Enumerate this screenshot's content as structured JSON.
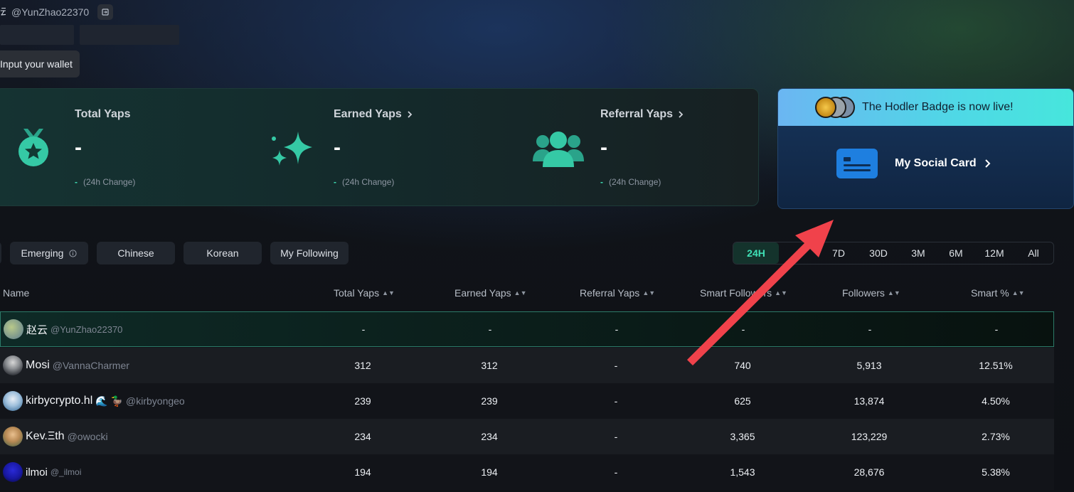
{
  "header": {
    "glyph": "云",
    "handle": "@YunZhao22370",
    "wallet_button": "Input your wallet"
  },
  "stats": [
    {
      "label": "Total Yaps",
      "value": "-",
      "change_value": "-",
      "change_label": "(24h Change)",
      "has_link": false
    },
    {
      "label": "Earned Yaps",
      "value": "-",
      "change_value": "-",
      "change_label": "(24h Change)",
      "has_link": true
    },
    {
      "label": "Referral Yaps",
      "value": "-",
      "change_value": "-",
      "change_label": "(24h Change)",
      "has_link": true
    }
  ],
  "promo": {
    "banner_text": "The Hodler Badge is now live!",
    "social_label": "My Social Card"
  },
  "filters": [
    "Emerging",
    "Chinese",
    "Korean",
    "My Following"
  ],
  "periods": [
    "24H",
    "7D",
    "30D",
    "3M",
    "6M",
    "12M",
    "All"
  ],
  "active_period": "24H",
  "table": {
    "headers": [
      "Name",
      "Total Yaps",
      "Earned Yaps",
      "Referral Yaps",
      "Smart Followers",
      "Followers",
      "Smart %"
    ],
    "rows": [
      {
        "display": "赵云",
        "handle": "@YunZhao22370",
        "emoji": "",
        "total": "-",
        "earned": "-",
        "referral": "-",
        "smart_followers": "-",
        "followers": "-",
        "smart_pct": "-"
      },
      {
        "display": "Mosi",
        "handle": "@VannaCharmer",
        "emoji": "",
        "total": "312",
        "earned": "312",
        "referral": "-",
        "smart_followers": "740",
        "followers": "5,913",
        "smart_pct": "12.51%"
      },
      {
        "display": "kirbycrypto.hl",
        "handle": "@kirbyongeo",
        "emoji": "🌊 🦆",
        "total": "239",
        "earned": "239",
        "referral": "-",
        "smart_followers": "625",
        "followers": "13,874",
        "smart_pct": "4.50%"
      },
      {
        "display": "Kev.Ξth",
        "handle": "@owocki",
        "emoji": "",
        "total": "234",
        "earned": "234",
        "referral": "-",
        "smart_followers": "3,365",
        "followers": "123,229",
        "smart_pct": "2.73%"
      },
      {
        "display": "ilmoi",
        "handle": "@_ilmoi",
        "emoji": "",
        "total": "194",
        "earned": "194",
        "referral": "-",
        "smart_followers": "1,543",
        "followers": "28,676",
        "smart_pct": "5.38%"
      }
    ]
  },
  "colors": {
    "accent": "#3fe0b6",
    "arrow": "#f0424b",
    "social_card": "#1e7fe0"
  }
}
